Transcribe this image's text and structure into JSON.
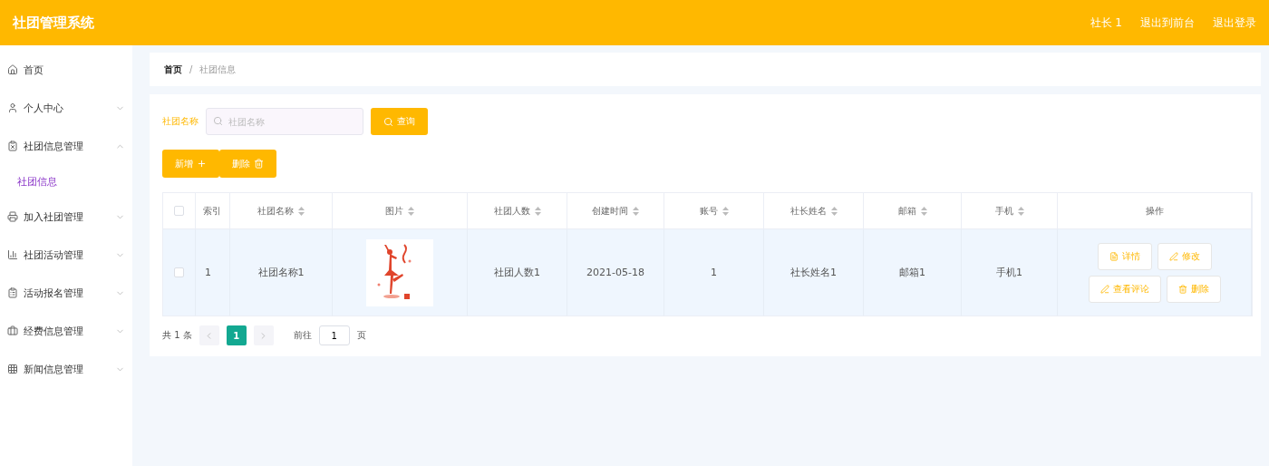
{
  "header": {
    "title": "社团管理系统",
    "links": [
      "社长 1",
      "退出到前台",
      "退出登录"
    ]
  },
  "sidebar": {
    "items": [
      {
        "label": "首页"
      },
      {
        "label": "个人中心",
        "expanded": false
      },
      {
        "label": "社团信息管理",
        "expanded": true,
        "children": [
          {
            "label": "社团信息",
            "selected": true
          }
        ]
      },
      {
        "label": "加入社团管理",
        "expanded": false
      },
      {
        "label": "社团活动管理",
        "expanded": false
      },
      {
        "label": "活动报名管理",
        "expanded": false
      },
      {
        "label": "经费信息管理",
        "expanded": false
      },
      {
        "label": "新闻信息管理",
        "expanded": false
      }
    ]
  },
  "breadcrumb": {
    "items": [
      "首页",
      "社团信息"
    ],
    "separator": "/"
  },
  "search": {
    "label": "社团名称",
    "placeholder": "社团名称",
    "button": "查询"
  },
  "actions": [
    "新增",
    "删除"
  ],
  "table": {
    "all_checked": false,
    "columns": [
      {
        "label": "索引",
        "sortable": false
      },
      {
        "label": "社团名称",
        "sortable": true
      },
      {
        "label": "图片",
        "sortable": true
      },
      {
        "label": "社团人数",
        "sortable": true
      },
      {
        "label": "创建时间",
        "sortable": true
      },
      {
        "label": "账号",
        "sortable": true
      },
      {
        "label": "社长姓名",
        "sortable": true
      },
      {
        "label": "邮箱",
        "sortable": true
      },
      {
        "label": "手机",
        "sortable": true
      },
      {
        "label": "操作",
        "sortable": false
      }
    ],
    "rows": [
      {
        "checked": false,
        "cells": [
          {
            "kind": "text",
            "text": "1"
          },
          {
            "kind": "text",
            "text": "社团名称1"
          },
          {
            "kind": "picture"
          },
          {
            "kind": "text",
            "text": "社团人数1"
          },
          {
            "kind": "text",
            "text": "2021-05-18"
          },
          {
            "kind": "text",
            "text": "1"
          },
          {
            "kind": "text",
            "text": "社长姓名1"
          },
          {
            "kind": "text",
            "text": "邮箱1"
          },
          {
            "kind": "text",
            "text": "手机1"
          }
        ],
        "buttons": [
          "详情",
          "修改",
          "查看评论",
          "删除"
        ]
      }
    ]
  },
  "pagination": {
    "total": "共 1 条",
    "pages": [
      {
        "label": "1",
        "selected": true
      }
    ],
    "goto_label": "前往",
    "goto_value": "1",
    "page_unit": "页"
  }
}
